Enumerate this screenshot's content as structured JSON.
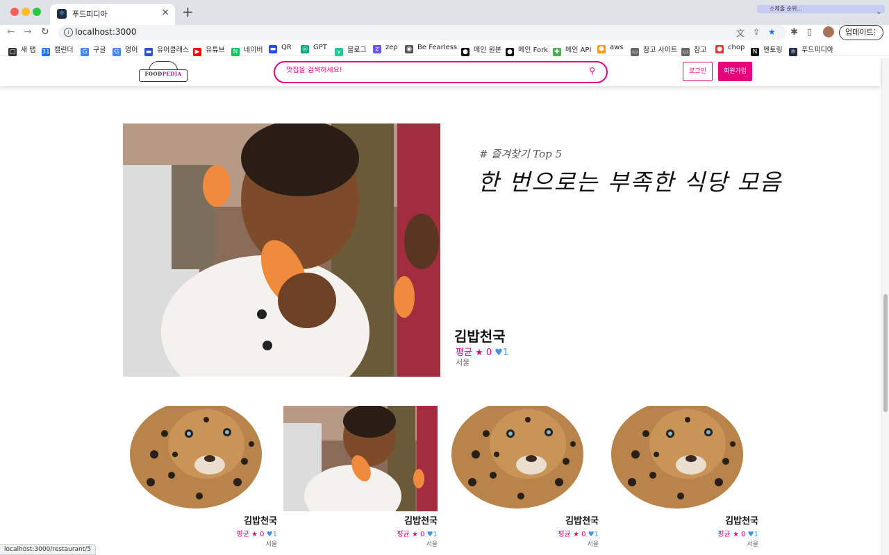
{
  "browser": {
    "tab_title": "푸드피디아",
    "url": "localhost:3000",
    "profile_chip": "스케줄 순위...",
    "update_label": "업데이트",
    "status_url": "localhost:3000/restaurant/5",
    "bookmarks": [
      {
        "label": "새 탭",
        "icon": "new-tab-icon",
        "color": "#333333"
      },
      {
        "label": "캘린더",
        "icon": "calendar-icon",
        "color": "#1a73e8"
      },
      {
        "label": "구글",
        "icon": "google-icon",
        "color": "#4285f4"
      },
      {
        "label": "영어",
        "icon": "google-icon",
        "color": "#4285f4"
      },
      {
        "label": "유어클래스",
        "icon": "class-icon",
        "color": "#2b4fd1"
      },
      {
        "label": "유튜브",
        "icon": "youtube-icon",
        "color": "#ff0000"
      },
      {
        "label": "네이버",
        "icon": "naver-icon",
        "color": "#03c75a"
      },
      {
        "label": "QR",
        "icon": "class-icon",
        "color": "#2b4fd1"
      },
      {
        "label": "GPT",
        "icon": "gpt-icon",
        "color": "#10a37f"
      },
      {
        "label": "블로그",
        "icon": "velog-icon",
        "color": "#20c997"
      },
      {
        "label": "zep",
        "icon": "zep-icon",
        "color": "#6758ff"
      },
      {
        "label": "Be Fearless",
        "icon": "eye-icon",
        "color": "#555555"
      },
      {
        "label": "메인 원본",
        "icon": "github-icon",
        "color": "#111111"
      },
      {
        "label": "메인 Fork",
        "icon": "github-icon",
        "color": "#111111"
      },
      {
        "label": "메인 API",
        "icon": "puzzle-icon",
        "color": "#4caf50"
      },
      {
        "label": "aws",
        "icon": "aws-icon",
        "color": "#ff9900"
      },
      {
        "label": "참고 사이트",
        "icon": "folder-icon",
        "color": "#666666"
      },
      {
        "label": "참고",
        "icon": "folder-icon",
        "color": "#666666"
      },
      {
        "label": "chop",
        "icon": "tomato-icon",
        "color": "#e53935"
      },
      {
        "label": "멘토링",
        "icon": "notion-icon",
        "color": "#111111"
      },
      {
        "label": "푸드피디아",
        "icon": "react-icon",
        "color": "#1f2a44"
      }
    ]
  },
  "header": {
    "logo_text_a": "FOOD",
    "logo_text_b": "PEDIA",
    "search_placeholder": "맛집을 검색하세요!",
    "login_label": "로그인",
    "signup_label": "회원가입"
  },
  "hero": {
    "subtitle": "# 즐겨찾기 Top 5",
    "title": "한 번으로는 부족한 식당 모음",
    "name": "김밥천국",
    "avg_label": "평균",
    "rating": "0",
    "likes": "1",
    "region": "서울"
  },
  "cards": [
    {
      "name": "김밥천국",
      "avg_label": "평균",
      "rating": "0",
      "likes": "1",
      "region": "서울",
      "image": "leopard"
    },
    {
      "name": "김밥천국",
      "avg_label": "평균",
      "rating": "0",
      "likes": "1",
      "region": "서울",
      "image": "boy"
    },
    {
      "name": "김밥천국",
      "avg_label": "평균",
      "rating": "0",
      "likes": "1",
      "region": "서울",
      "image": "leopard"
    },
    {
      "name": "김밥천국",
      "avg_label": "평균",
      "rating": "0",
      "likes": "1",
      "region": "서울",
      "image": "leopard"
    }
  ],
  "colors": {
    "brand": "#e6007e",
    "like": "#4a90e2"
  }
}
